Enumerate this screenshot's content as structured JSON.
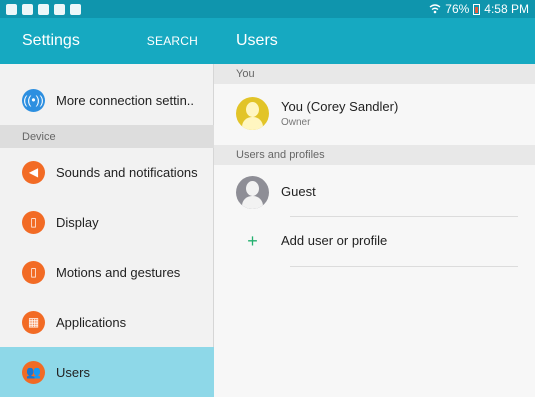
{
  "status_bar": {
    "battery": "76%",
    "time": "4:58 PM",
    "left_icons": [
      "nfc-icon",
      "gallery-icon",
      "clock-icon",
      "clock-icon",
      "chat-icon"
    ],
    "right_icons": [
      "wifi-icon",
      "battery-icon"
    ]
  },
  "header": {
    "settings_title": "Settings",
    "search_label": "SEARCH",
    "users_title": "Users"
  },
  "sidebar": {
    "items": [
      {
        "label": "More connection settin..",
        "icon": "connection-icon",
        "color": "#2d8fe0"
      },
      {
        "label": "Sounds and notifications",
        "icon": "sound-icon",
        "color": "#f26b25"
      },
      {
        "label": "Display",
        "icon": "display-icon",
        "color": "#f26b25"
      },
      {
        "label": "Motions and gestures",
        "icon": "motion-icon",
        "color": "#f26b25"
      },
      {
        "label": "Applications",
        "icon": "apps-icon",
        "color": "#f26b25"
      },
      {
        "label": "Users",
        "icon": "users-icon",
        "color": "#f26b25",
        "active": true
      }
    ],
    "section_device": "Device"
  },
  "main": {
    "section_you": "You",
    "owner": {
      "name": "You (Corey Sandler)",
      "role": "Owner"
    },
    "section_profiles": "Users and profiles",
    "guest": {
      "name": "Guest"
    },
    "add_user": {
      "label": "Add user or profile"
    }
  },
  "colors": {
    "status_bar": "#0f95ad",
    "header": "#16a9c1",
    "active_item": "#8ed8e8",
    "icon_blue": "#2d8fe0",
    "icon_orange": "#f26b25",
    "plus_green": "#23b06f"
  }
}
